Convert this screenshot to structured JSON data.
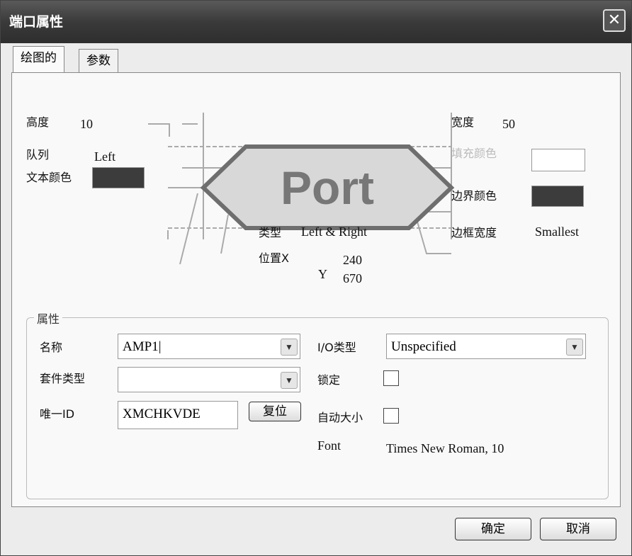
{
  "window": {
    "title": "端口属性",
    "close_icon": "close-icon"
  },
  "tabs": [
    {
      "label": "绘图的",
      "active": true
    },
    {
      "label": "参数",
      "active": false
    }
  ],
  "drawing": {
    "height_label": "高度",
    "height_value": "10",
    "align_label": "队列",
    "align_value": "Left",
    "text_color_label": "文本颜色",
    "text_color": "#3c3c3c",
    "width_label": "宽度",
    "width_value": "50",
    "fill_color_label": "填充颜色",
    "fill_color": "#ffffff",
    "border_color_label": "边界颜色",
    "border_color": "#3c3c3c",
    "border_width_label": "边框宽度",
    "border_width_value": "Smallest",
    "type_label": "类型",
    "type_value": "Left & Right",
    "pos_x_label": "位置X",
    "pos_x_value": "240",
    "pos_y_label": "Y",
    "pos_y_value": "670",
    "preview_text": "Port"
  },
  "properties": {
    "group_label": "属性",
    "name_label": "名称",
    "name_value": "AMP1",
    "io_type_label": "I/O类型",
    "io_type_value": "Unspecified",
    "part_type_label": "套件类型",
    "part_type_value": "",
    "lock_label": "锁定",
    "lock_checked": false,
    "unique_id_label": "唯一ID",
    "unique_id_value": "XMCHKVDE",
    "reset_label": "复位",
    "autosize_label": "自动大小",
    "autosize_checked": false,
    "font_label": "Font",
    "font_value": "Times New Roman, 10"
  },
  "footer": {
    "ok_label": "确定",
    "cancel_label": "取消"
  }
}
